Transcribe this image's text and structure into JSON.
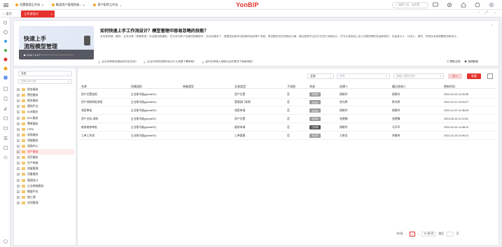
{
  "top_tabs": [
    {
      "label": "设置管理工作台"
    },
    {
      "label": "集团资产管理首板..."
    },
    {
      "label": "资产租赁工作台"
    }
  ],
  "brand": "YonBIP",
  "search": {
    "placeholder": "搜索人员、应用等"
  },
  "page_tab": {
    "home": "首页",
    "active": "工作流设计"
  },
  "banner": {
    "video_title_1": "快速上手",
    "video_title_2": "流程模型管理",
    "video_time": "0:00 / 3:17",
    "title": "如何快速上手工作流设计？模型管理中容易忽略的技能？",
    "desc": "支持按领域、模块、业务对象（单据类型）来创建流程模型。在业务对象下创建流程模型时，支持创建多个，根据发起条件控制具体发起哪个流程。提供图形化的流程设计器，通过拖拽节点的方式进行流程设计。在节点或连线上定义流程所需的变量和条件，包括参与人、抄送人、操作、时限及消息提醒等流程设计。",
    "links": [
      "企业内审核流程如何可定关系？",
      "企业内采购流程的设计什么场景下需审核？",
      "如何在审核人审核为空的情况下继续审核？"
    ],
    "right_links": [
      "帮助文档",
      "视频教程"
    ]
  },
  "left_panel": {
    "domain_select": "业务",
    "search_placeholder": "搜索业务对象",
    "tree": [
      {
        "label": "财务服务"
      },
      {
        "label": "费控服务"
      },
      {
        "label": "税务服务"
      },
      {
        "label": "营销平台"
      },
      {
        "label": "B2B服务"
      },
      {
        "label": "B2C服务"
      },
      {
        "label": "零售服务"
      },
      {
        "label": "CRM"
      },
      {
        "label": "采购服务"
      },
      {
        "label": "领域服务"
      },
      {
        "label": "采购中心"
      },
      {
        "label": "资产服务",
        "selected": true
      },
      {
        "label": "项目服务"
      },
      {
        "label": "生产制造"
      },
      {
        "label": "质量管理"
      },
      {
        "label": "设备服务"
      },
      {
        "label": "管理会计"
      },
      {
        "label": "企业绩效服务"
      },
      {
        "label": "数据平台"
      },
      {
        "label": "施工理"
      },
      {
        "label": "合同管理"
      }
    ]
  },
  "filters": {
    "status": "全部",
    "name_placeholder": "名称",
    "creator_placeholder": "请输入模型名称",
    "import_label": "导入",
    "new_label": "新建"
  },
  "table": {
    "headers": [
      "名称",
      "所属组织",
      "单据类型",
      "交易类型",
      "子流程",
      "状态",
      "创建人",
      "最后修改人",
      "更新时间"
    ],
    "rows": [
      {
        "name": "资产位置流程",
        "org": "企业账号级(global00)",
        "doc": "",
        "trade": "资产位置",
        "sub": "否",
        "state": "未发布",
        "creator": "顾晓玲",
        "modifier": "顾晓玲",
        "time": "2024-02-02 11:05:56"
      },
      {
        "name": "资产采购审批流程",
        "org": "企业账号级(global00)",
        "doc": "",
        "trade": "管理部门采购",
        "sub": "否",
        "state": "未发布",
        "creator": "张光辉",
        "modifier": "陈光辉",
        "time": "2023-12-21 19:34:27"
      },
      {
        "name": "领用审批",
        "org": "企业账号级(global00)",
        "doc": "",
        "trade": "领用申请",
        "sub": "否",
        "state": "未发布",
        "creator": "顾晓玲",
        "modifier": "顾晓玲",
        "time": "2023-12-20 11:36:09"
      },
      {
        "name": "资产业务-采购",
        "org": "企业账号级(global00)",
        "doc": "",
        "trade": "资产位置",
        "sub": "否",
        "state": "未发布",
        "creator": "张德臻",
        "modifier": "张德臻",
        "time": "2023-05-16 11:24:51"
      },
      {
        "name": "维修维修审批",
        "org": "企业账号级(global00)",
        "doc": "",
        "trade": "维修申请",
        "sub": "否",
        "state": "已停用",
        "creator": "顾晓玲",
        "modifier": "马开军",
        "time": "2024-01-24 14:48:12"
      },
      {
        "name": "工单工作流",
        "org": "企业账号级(global00)",
        "doc": "",
        "trade": "工单管理",
        "sub": "否",
        "state": "未发布",
        "creator": "王晓龙",
        "modifier": "李建伟",
        "time": "2023-10-15 10:46:41"
      }
    ]
  },
  "pager": {
    "total": "共6条",
    "page": "1",
    "size": "10 条/页",
    "goto": "跳至",
    "page_unit": "页"
  },
  "colors": {
    "accent": "#e5322d",
    "state_unpublished": "#9b9b9b",
    "state_disabled": "#555555"
  }
}
